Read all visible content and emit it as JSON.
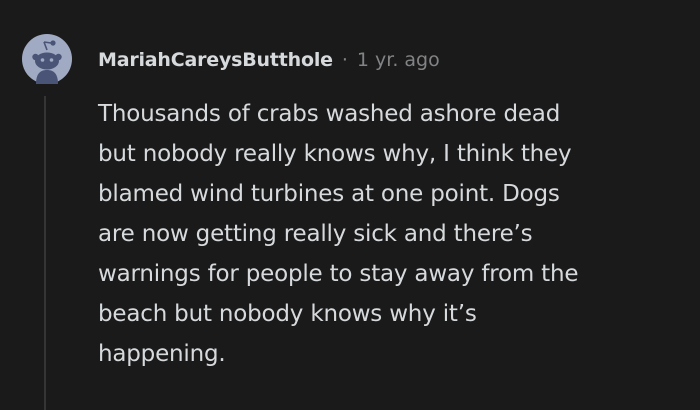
{
  "comment": {
    "username": "MariahCareysButthole",
    "separator": "·",
    "timestamp": "1 yr. ago",
    "lines": [
      "Thousands of crabs washed ashore dead",
      "but nobody really knows why, I think they",
      "blamed wind turbines at one point. Dogs",
      "are now getting really sick and there’s",
      "warnings for people to stay away from the",
      "beach but nobody knows why it’s",
      "happening."
    ]
  },
  "colors": {
    "background": "#1a1a1b",
    "text_primary": "#d7dadc",
    "text_secondary": "#818384",
    "thread_line": "#343536",
    "avatar_bg": "#a0aac2",
    "avatar_face": "#4a5477"
  },
  "icons": {
    "avatar": "reddit-snoo-avatar-icon"
  }
}
